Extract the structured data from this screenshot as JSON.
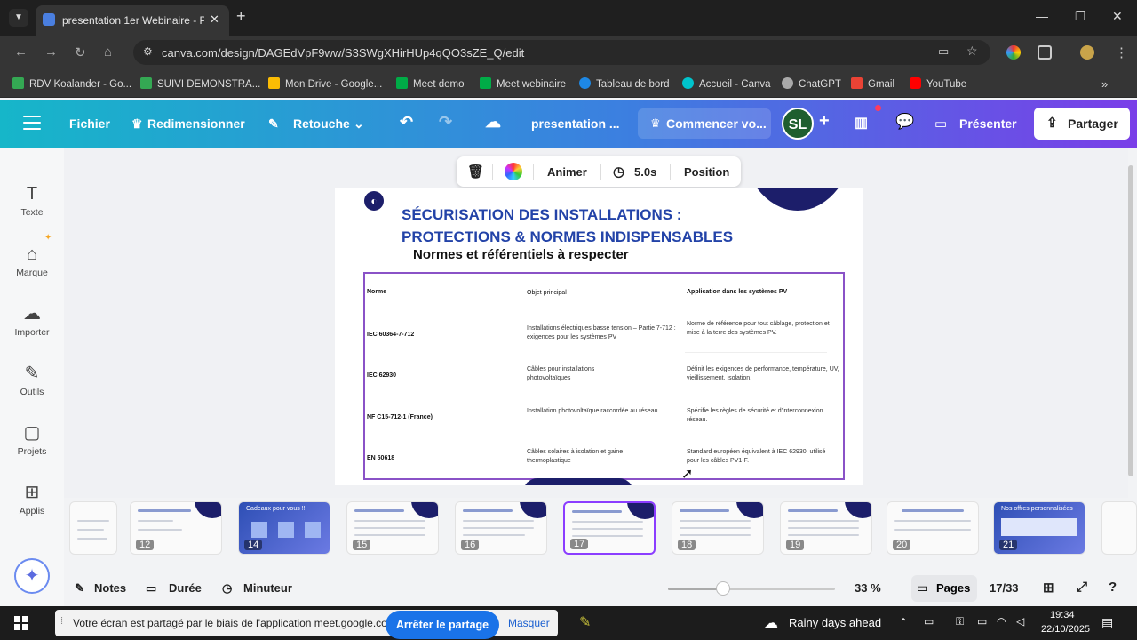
{
  "browser": {
    "tab_title": "presentation 1er Webinaire - P",
    "url": "canva.com/design/DAGEdVpF9ww/S3SWgXHirHUp4qQO3sZE_Q/edit",
    "bookmarks": [
      {
        "label": "RDV Koalander - Go...",
        "color": "#34a853"
      },
      {
        "label": "SUIVI DEMONSTRA...",
        "color": "#34a853"
      },
      {
        "label": "Mon Drive - Google...",
        "color": "#fbbc04"
      },
      {
        "label": "Meet demo",
        "color": "#00ac47"
      },
      {
        "label": "Meet webinaire",
        "color": "#00ac47"
      },
      {
        "label": "Tableau de bord",
        "color": "#1e88e5"
      },
      {
        "label": "Accueil - Canva",
        "color": "#00c4cc"
      },
      {
        "label": "ChatGPT",
        "color": "#aaaaaa"
      },
      {
        "label": "Gmail",
        "color": "#ea4335"
      },
      {
        "label": "YouTube",
        "color": "#ff0000"
      }
    ]
  },
  "canva_header": {
    "fichier": "Fichier",
    "redimensionner": "Redimensionner",
    "retouche": "Retouche",
    "doc_title": "presentation ...",
    "commencer": "Commencer vo...",
    "avatar": "SL",
    "presenter": "Présenter",
    "partager": "Partager"
  },
  "sidebar": [
    {
      "icon": "T",
      "label": "Texte"
    },
    {
      "icon": "⌂",
      "label": "Marque"
    },
    {
      "icon": "☁",
      "label": "Importer"
    },
    {
      "icon": "✎",
      "label": "Outils"
    },
    {
      "icon": "▢",
      "label": "Projets"
    },
    {
      "icon": "⊞",
      "label": "Applis"
    }
  ],
  "context_toolbar": {
    "animer": "Animer",
    "duration": "5.0s",
    "position": "Position"
  },
  "slide": {
    "title_line1": "SÉCURISATION DES INSTALLATIONS :",
    "title_line2": "PROTECTIONS & NORMES INDISPENSABLES",
    "subtitle": "Normes et référentiels à respecter",
    "table": {
      "headers": [
        "Norme",
        "Objet principal",
        "Application dans les systèmes PV"
      ],
      "rows": [
        [
          "IEC 60364-7-712",
          "Installations électriques basse tension – Partie 7-712 : exigences pour les systèmes PV",
          "Norme de référence pour tout câblage, protection et mise à la terre des systèmes PV."
        ],
        [
          "IEC 62930",
          "Câbles pour installations photovoltaïques",
          "Définit les exigences de performance, température, UV, vieillissement, isolation."
        ],
        [
          "NF C15-712-1 (France)",
          "Installation photovoltaïque raccordée au réseau",
          "Spécifie les règles de sécurité et d'interconnexion réseau."
        ],
        [
          "EN 50618",
          "Câbles solaires à isolation et gaine thermoplastique",
          "Standard européen équivalent à IEC 62930, utilisé pour les câbles PV1-F."
        ]
      ]
    }
  },
  "thumbnails": [
    {
      "num": "",
      "sel": false,
      "blue": false
    },
    {
      "num": "12",
      "sel": false,
      "blue": false
    },
    {
      "num": "14",
      "sel": false,
      "blue": true
    },
    {
      "num": "15",
      "sel": false,
      "blue": false
    },
    {
      "num": "16",
      "sel": false,
      "blue": false
    },
    {
      "num": "17",
      "sel": true,
      "blue": false
    },
    {
      "num": "18",
      "sel": false,
      "blue": false
    },
    {
      "num": "19",
      "sel": false,
      "blue": false
    },
    {
      "num": "20",
      "sel": false,
      "blue": false
    },
    {
      "num": "21",
      "sel": false,
      "blue": true
    }
  ],
  "thumb_titles": {
    "t14": "Cadeaux pour vous !!!",
    "t21": "Nos offres personnalisées"
  },
  "footer": {
    "notes": "Notes",
    "duree": "Durée",
    "minuteur": "Minuteur",
    "zoom": "33 %",
    "zoom_fraction": 0.33,
    "pages": "Pages",
    "page_count": "17/33"
  },
  "taskbar": {
    "notice": "Votre écran est partagé par le biais de l'application meet.google.com.",
    "stop_share": "Arrêter le partage",
    "hide": "Masquer",
    "weather": "Rainy days ahead",
    "time": "19:34",
    "date": "22/10/2025"
  }
}
